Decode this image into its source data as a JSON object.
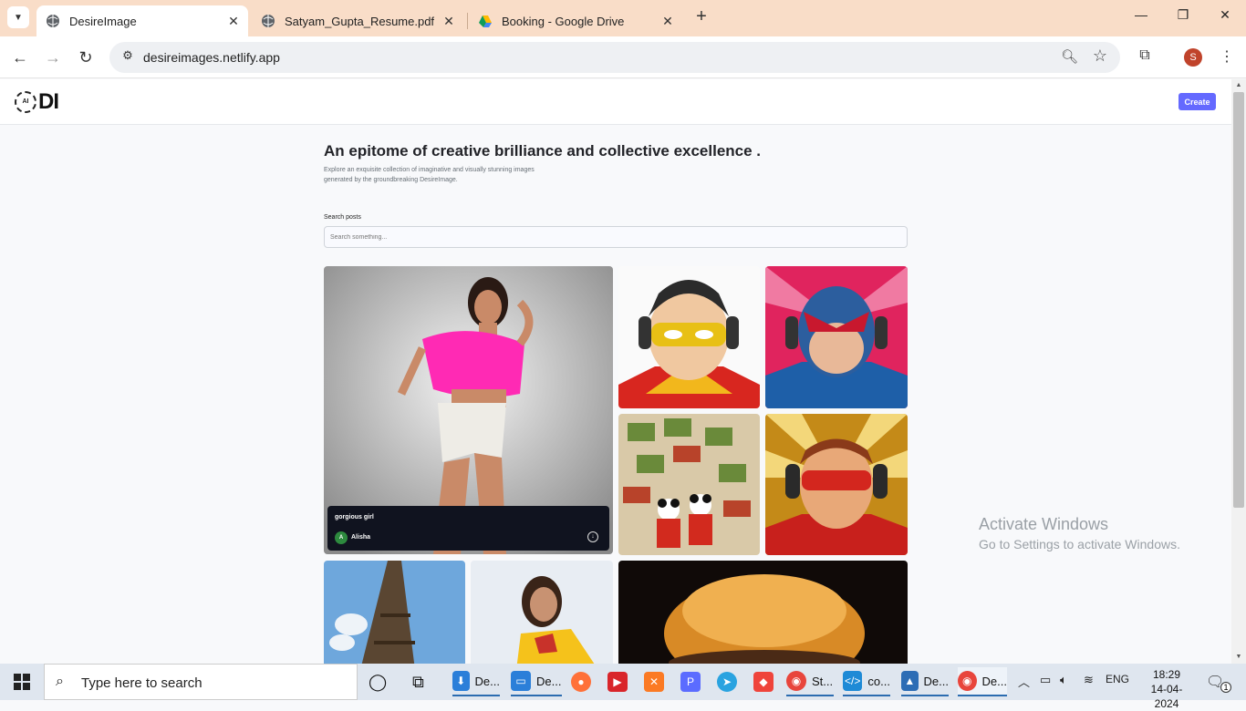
{
  "browser": {
    "tabs": [
      {
        "title": "DesireImage",
        "active": true
      },
      {
        "title": "Satyam_Gupta_Resume.pdf",
        "active": false
      },
      {
        "title": "Booking - Google Drive",
        "active": false
      }
    ],
    "url": "desireimages.netlify.app",
    "profile_initial": "S"
  },
  "site": {
    "logo_badge": "AI",
    "logo_text": "DI",
    "create_label": "Create",
    "hero_title": "An epitome of creative brilliance and collective excellence .",
    "hero_subtitle": "Explore an exquisite collection of imaginative and visually stunning images generated by the groundbreaking DesireImage.",
    "search_label": "Search posts",
    "search_placeholder": "Search something...",
    "featured_post": {
      "prompt": "gorgious girl",
      "author": "Alisha",
      "author_initial": "A"
    }
  },
  "watermark": {
    "line1": "Activate Windows",
    "line2": "Go to Settings to activate Windows."
  },
  "taskbar": {
    "search_placeholder": "Type here to search",
    "apps": [
      {
        "label": "De...",
        "icon": "download-icon",
        "color": "#2b7fd9"
      },
      {
        "label": "De...",
        "icon": "desktop-icon",
        "color": "#2b7fd9"
      },
      {
        "label": "",
        "icon": "firefox-icon",
        "color": "#ff7139"
      },
      {
        "label": "",
        "icon": "camera-icon",
        "color": "#d9252a"
      },
      {
        "label": "",
        "icon": "xampp-icon",
        "color": "#fb7a24"
      },
      {
        "label": "",
        "icon": "p-icon",
        "color": "#5b6cff"
      },
      {
        "label": "",
        "icon": "telegram-icon",
        "color": "#2aa3e0"
      },
      {
        "label": "",
        "icon": "anydesk-icon",
        "color": "#ef443b"
      },
      {
        "label": "St...",
        "icon": "chrome-icon",
        "color": "#e8453c"
      },
      {
        "label": "co...",
        "icon": "vscode-icon",
        "color": "#1e8ad6"
      },
      {
        "label": "De...",
        "icon": "photos-icon",
        "color": "#2d6db5"
      },
      {
        "label": "De...",
        "icon": "chrome-icon",
        "color": "#e8453c"
      }
    ],
    "language": "ENG",
    "time": "18:29",
    "date": "14-04-2024",
    "notification_count": "1"
  }
}
